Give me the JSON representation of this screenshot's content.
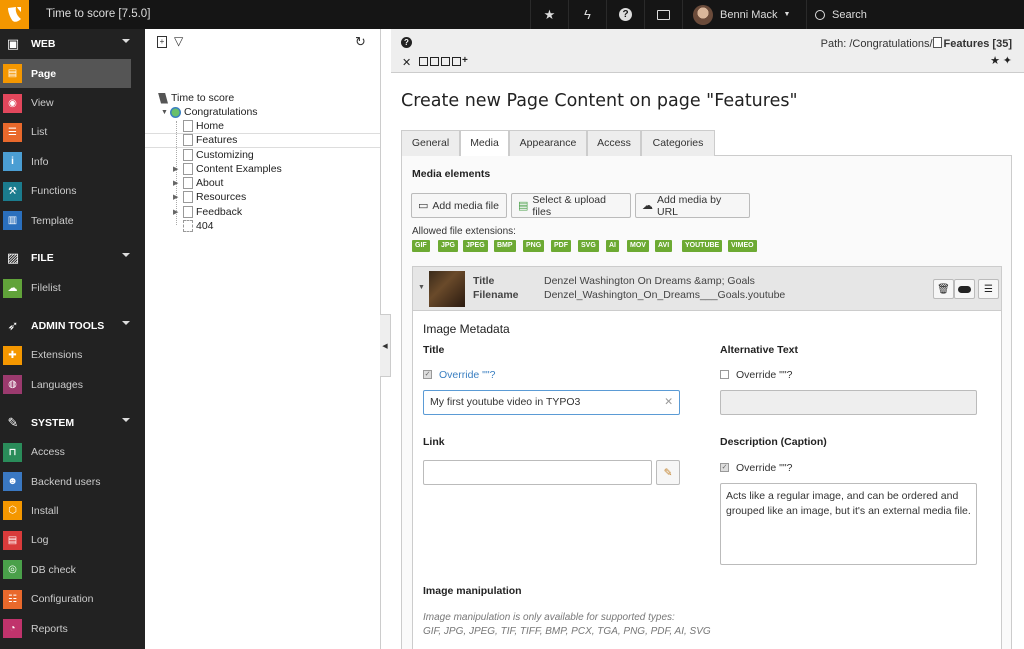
{
  "topbar": {
    "site_title": "Time to score [7.5.0]",
    "user_name": "Benni Mack",
    "search_label": "Search"
  },
  "modules": {
    "groups": [
      {
        "label": "WEB",
        "items": [
          "Page",
          "View",
          "List",
          "Info",
          "Functions",
          "Template"
        ]
      },
      {
        "label": "FILE",
        "items": [
          "Filelist"
        ]
      },
      {
        "label": "ADMIN TOOLS",
        "items": [
          "Extensions",
          "Languages"
        ]
      },
      {
        "label": "SYSTEM",
        "items": [
          "Access",
          "Backend users",
          "Install",
          "Log",
          "DB check",
          "Configuration",
          "Reports"
        ]
      }
    ],
    "active": "Page"
  },
  "tree": {
    "root": "Time to score",
    "nodes": [
      "Congratulations",
      "Home",
      "Features",
      "Customizing",
      "Content Examples",
      "About",
      "Resources",
      "Feedback",
      "404"
    ]
  },
  "docheader": {
    "path_prefix": "Path: /Congratulations/",
    "path_current": "Features [35]"
  },
  "heading": "Create new Page Content on page \"Features\"",
  "tabs": [
    "General",
    "Media",
    "Appearance",
    "Access",
    "Categories"
  ],
  "active_tab": "Media",
  "media": {
    "section_label": "Media elements",
    "add_file": "Add media file",
    "select_upload": "Select & upload files",
    "add_url": "Add media by URL",
    "allowed_label": "Allowed file extensions:",
    "extensions": [
      "GIF",
      "JPG",
      "JPEG",
      "BMP",
      "PNG",
      "PDF",
      "SVG",
      "AI",
      "MOV",
      "AVI",
      "YOUTUBE",
      "VIMEO"
    ]
  },
  "file": {
    "title_label": "Title",
    "title_value": "Denzel Washington On Dreams &amp; Goals",
    "filename_label": "Filename",
    "filename_value": "Denzel_Washington_On_Dreams___Goals.youtube"
  },
  "meta": {
    "heading": "Image Metadata",
    "title_label": "Title",
    "title_override": "Override \"\"?",
    "title_value": "My first youtube video in TYPO3",
    "alt_label": "Alternative Text",
    "alt_override": "Override \"\"?",
    "link_label": "Link",
    "desc_label": "Description (Caption)",
    "desc_override": "Override \"\"?",
    "desc_value": "Acts like a regular image, and can be ordered and grouped like an image, but it's an external media file."
  },
  "manip": {
    "label": "Image manipulation",
    "note_line1": "Image manipulation is only available for supported types:",
    "note_line2": "GIF, JPG, JPEG, TIF, TIFF, BMP, PCX, TGA, PNG, PDF, AI, SVG"
  },
  "colors": {
    "topbar": "#151515",
    "logo": "#f49700",
    "menu": "#222222",
    "ext_badge": "#6daa33"
  }
}
